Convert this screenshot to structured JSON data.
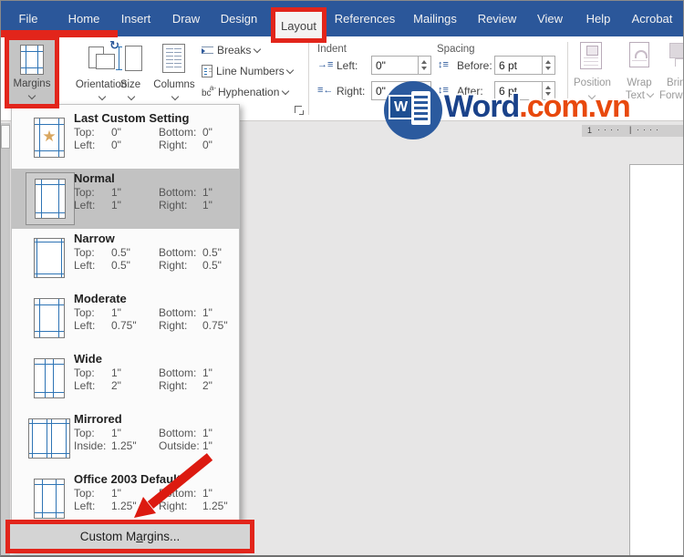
{
  "menubar": {
    "tabs": [
      "File",
      "Home",
      "Insert",
      "Draw",
      "Design",
      "Layout",
      "References",
      "Mailings",
      "Review",
      "View",
      "Help",
      "Acrobat"
    ],
    "active_tab": "Layout"
  },
  "ribbon": {
    "margins_label": "Margins",
    "orientation_label": "Orientation",
    "size_label": "Size",
    "columns_label": "Columns",
    "breaks_label": "Breaks",
    "line_numbers_label": "Line Numbers",
    "hyphenation_label": "Hyphenation",
    "hyphenation_icon": {
      "main": "bc",
      "sup": "a-"
    },
    "indent": {
      "label": "Indent",
      "left_label": "Left:",
      "left_value": "0\"",
      "right_label": "Right:",
      "right_value": "0\""
    },
    "spacing": {
      "label": "Spacing",
      "before_label": "Before:",
      "before_value": "6 pt",
      "after_label": "After:",
      "after_value": "6 pt"
    },
    "position_label": "Position",
    "wrap_text_line1": "Wrap",
    "wrap_text_line2": "Text",
    "bring_forward_line1": "Bring",
    "bring_forward_line2": "Forward",
    "indent_left_icon": "→≡",
    "indent_right_icon": "≡←",
    "spacing_before_icon": "↕≡",
    "spacing_after_icon": "↕≡",
    "paragraph_group_fragment": "g"
  },
  "logo": {
    "initial": "W",
    "word": "Word",
    "domain": ".com.vn"
  },
  "ruler": {
    "number": "1",
    "ticks_left": "····",
    "separator": "|",
    "ticks_right": "····"
  },
  "dropdown": {
    "items": [
      {
        "name": "Last Custom Setting",
        "selected": false,
        "rows": [
          [
            "Top:",
            "0\"",
            "Bottom:",
            "0\""
          ],
          [
            "Left:",
            "0\"",
            "Right:",
            "0\""
          ]
        ]
      },
      {
        "name": "Normal",
        "selected": true,
        "rows": [
          [
            "Top:",
            "1\"",
            "Bottom:",
            "1\""
          ],
          [
            "Left:",
            "1\"",
            "Right:",
            "1\""
          ]
        ]
      },
      {
        "name": "Narrow",
        "selected": false,
        "rows": [
          [
            "Top:",
            "0.5\"",
            "Bottom:",
            "0.5\""
          ],
          [
            "Left:",
            "0.5\"",
            "Right:",
            "0.5\""
          ]
        ]
      },
      {
        "name": "Moderate",
        "selected": false,
        "rows": [
          [
            "Top:",
            "1\"",
            "Bottom:",
            "1\""
          ],
          [
            "Left:",
            "0.75\"",
            "Right:",
            "0.75\""
          ]
        ]
      },
      {
        "name": "Wide",
        "selected": false,
        "rows": [
          [
            "Top:",
            "1\"",
            "Bottom:",
            "1\""
          ],
          [
            "Left:",
            "2\"",
            "Right:",
            "2\""
          ]
        ]
      },
      {
        "name": "Mirrored",
        "selected": false,
        "rows": [
          [
            "Top:",
            "1\"",
            "Bottom:",
            "1\""
          ],
          [
            "Inside:",
            "1.25\"",
            "Outside:",
            "1\""
          ]
        ]
      },
      {
        "name": "Office 2003 Default",
        "selected": false,
        "rows": [
          [
            "Top:",
            "1\"",
            "Bottom:",
            "1\""
          ],
          [
            "Left:",
            "1.25\"",
            "Right:",
            "1.25\""
          ]
        ]
      }
    ],
    "custom_margins": {
      "pre": "Custom M",
      "accel": "a",
      "post": "rgins..."
    }
  },
  "colors": {
    "ribbon_tab_blue": "#2B579A",
    "highlight_red": "#E2251B",
    "logo_blue": "#1A428A",
    "logo_orange": "#E8490D",
    "selected_gray": "#C2C2C2",
    "guide_line_blue": "#2E74B5"
  }
}
